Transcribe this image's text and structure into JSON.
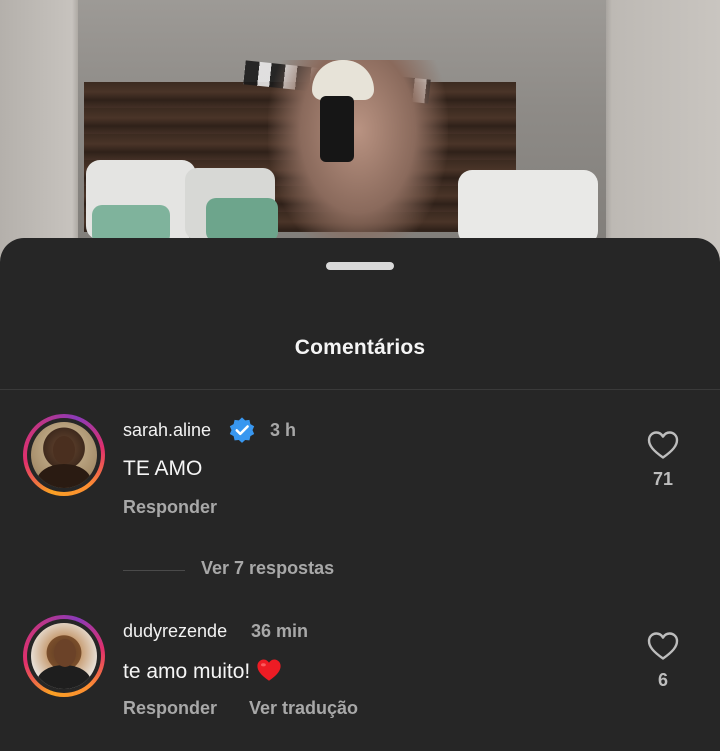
{
  "sheet": {
    "title": "Comentários"
  },
  "comments": [
    {
      "username": "sarah.aline",
      "verified": true,
      "time": "3 h",
      "text": "TE AMO",
      "reply_label": "Responder",
      "likes": "71",
      "view_replies_label": "Ver 7 respostas"
    },
    {
      "username": "dudyrezende",
      "verified": false,
      "time": "36 min",
      "text": "te amo muito!",
      "emoji": "red-heart-emoji",
      "reply_label": "Responder",
      "translate_label": "Ver tradução",
      "likes": "6"
    }
  ],
  "colors": {
    "sheet_background": "#262626",
    "primary_text": "#f5f5f5",
    "secondary_text": "#a8a8a8",
    "verified_blue": "#3897f0",
    "heart_red": "#ed1c24"
  }
}
